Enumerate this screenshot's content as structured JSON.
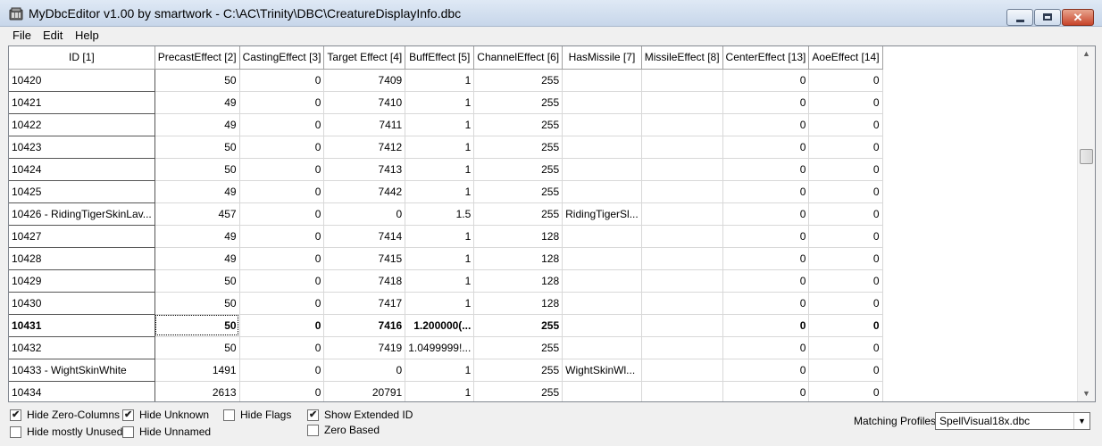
{
  "window": {
    "title": "MyDbcEditor v1.00 by smartwork - C:\\AC\\Trinity\\DBC\\CreatureDisplayInfo.dbc",
    "icon": "app-icon",
    "controls": {
      "minimize": "minimize-icon",
      "maximize": "maximize-icon",
      "close": "✕"
    }
  },
  "menu": {
    "items": [
      "File",
      "Edit",
      "Help"
    ]
  },
  "grid": {
    "columns": [
      "ID [1]",
      "PrecastEffect [2]",
      "CastingEffect [3]",
      "Target Effect [4]",
      "BuffEffect [5]",
      "ChannelEffect [6]",
      "HasMissile [7]",
      "MissileEffect [8]",
      "CenterEffect [13]",
      "AoeEffect [14]"
    ],
    "rows": [
      [
        "10420",
        "50",
        "0",
        "7409",
        "1",
        "255",
        "",
        "",
        "0",
        "0"
      ],
      [
        "10421",
        "49",
        "0",
        "7410",
        "1",
        "255",
        "",
        "",
        "0",
        "0"
      ],
      [
        "10422",
        "49",
        "0",
        "7411",
        "1",
        "255",
        "",
        "",
        "0",
        "0"
      ],
      [
        "10423",
        "50",
        "0",
        "7412",
        "1",
        "255",
        "",
        "",
        "0",
        "0"
      ],
      [
        "10424",
        "50",
        "0",
        "7413",
        "1",
        "255",
        "",
        "",
        "0",
        "0"
      ],
      [
        "10425",
        "49",
        "0",
        "7442",
        "1",
        "255",
        "",
        "",
        "0",
        "0"
      ],
      [
        "10426 - RidingTigerSkinLav...",
        "457",
        "0",
        "0",
        "1.5",
        "255",
        "RidingTigerSl...",
        "",
        "0",
        "0"
      ],
      [
        "10427",
        "49",
        "0",
        "7414",
        "1",
        "128",
        "",
        "",
        "0",
        "0"
      ],
      [
        "10428",
        "49",
        "0",
        "7415",
        "1",
        "128",
        "",
        "",
        "0",
        "0"
      ],
      [
        "10429",
        "50",
        "0",
        "7418",
        "1",
        "128",
        "",
        "",
        "0",
        "0"
      ],
      [
        "10430",
        "50",
        "0",
        "7417",
        "1",
        "128",
        "",
        "",
        "0",
        "0"
      ],
      [
        "10431",
        "50",
        "0",
        "7416",
        "1.200000(...",
        "255",
        "",
        "",
        "0",
        "0"
      ],
      [
        "10432",
        "50",
        "0",
        "7419",
        "1.0499999!...",
        "255",
        "",
        "",
        "0",
        "0"
      ],
      [
        "10433 - WightSkinWhite",
        "1491",
        "0",
        "0",
        "1",
        "255",
        "WightSkinWl...",
        "",
        "0",
        "0"
      ],
      [
        "10434",
        "2613",
        "0",
        "20791",
        "1",
        "255",
        "",
        "",
        "0",
        "0"
      ]
    ],
    "selected_row": 11,
    "scrollbar": {
      "up": "▲",
      "down": "▼"
    }
  },
  "options": {
    "hide_zero_columns": {
      "label": "Hide Zero-Columns",
      "checked": true
    },
    "hide_mostly_unused": {
      "label": "Hide mostly Unused",
      "checked": false
    },
    "hide_unknown": {
      "label": "Hide Unknown",
      "checked": true
    },
    "hide_unnamed": {
      "label": "Hide Unnamed",
      "checked": false
    },
    "hide_flags": {
      "label": "Hide Flags",
      "checked": false
    },
    "show_extended_id": {
      "label": "Show Extended ID",
      "checked": true
    },
    "zero_based": {
      "label": "Zero Based",
      "checked": false
    },
    "check_mark": "✔"
  },
  "profiles": {
    "label": "Matching Profiles:",
    "value": "SpellVisual18x.dbc",
    "arrow": "▼"
  }
}
